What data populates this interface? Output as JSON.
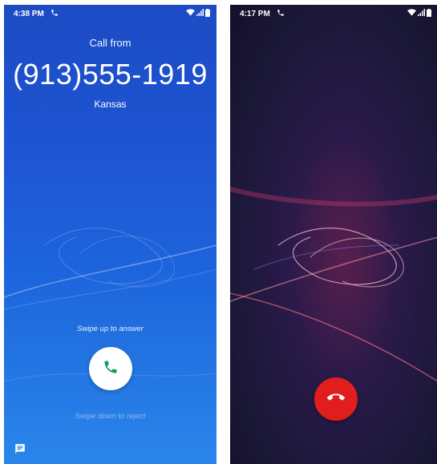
{
  "incoming_call": {
    "status_time": "4:38 PM",
    "call_from_label": "Call from",
    "phone_number": "(913)555-1919",
    "location": "Kansas",
    "swipe_up_hint": "Swipe up to answer",
    "swipe_down_hint": "Swipe down to reject",
    "answer_icon": "phone-icon",
    "message_icon": "message-icon",
    "accent_color": "#0f9d58"
  },
  "active_call": {
    "status_time": "4:17 PM",
    "hangup_icon": "call-end-icon",
    "hangup_color": "#e01e1e"
  }
}
